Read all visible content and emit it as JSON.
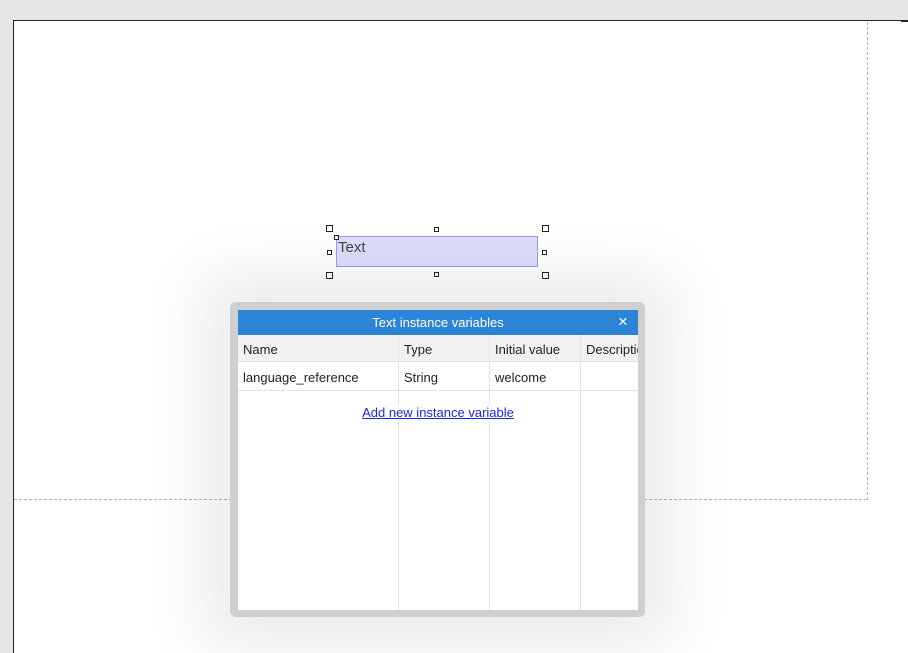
{
  "canvas": {
    "text_object_label": "Text"
  },
  "dialog": {
    "title": "Text instance variables",
    "close_icon": "×",
    "columns": [
      "Name",
      "Type",
      "Initial value",
      "Description"
    ],
    "rows": [
      {
        "name": "language_reference",
        "type": "String",
        "initial_value": "welcome",
        "description": ""
      }
    ],
    "add_link_label": "Add new instance variable"
  },
  "colors": {
    "titlebar": "#2b84d4",
    "selection_fill": "#dcdcfb",
    "link": "#2222ee"
  }
}
